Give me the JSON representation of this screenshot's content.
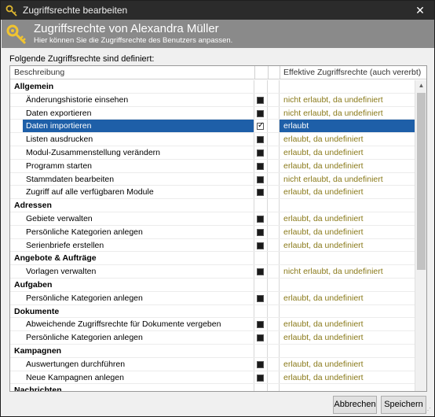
{
  "window": {
    "title": "Zugriffsrechte bearbeiten",
    "close_glyph": "✕"
  },
  "header": {
    "title": "Zugriffsrechte von Alexandra Müller",
    "subtitle": "Hier können Sie die Zugriffsrechte des Benutzers anpassen.",
    "icon": "key-icon"
  },
  "intro_text": "Folgende Zugriffsrechte sind definiert:",
  "grid": {
    "columns": [
      "Beschreibung",
      "",
      "",
      "Effektive Zugriffsrechte (auch vererbt)"
    ],
    "rows": [
      {
        "type": "group",
        "label": "Allgemein",
        "effective": ""
      },
      {
        "type": "item",
        "label": "Änderungshistorie einsehen",
        "checked": true,
        "effective": "nicht erlaubt, da undefiniert"
      },
      {
        "type": "item",
        "label": "Daten exportieren",
        "checked": true,
        "effective": "nicht erlaubt, da undefiniert"
      },
      {
        "type": "item",
        "label": "Daten importieren",
        "checked": true,
        "selected": true,
        "effective": "erlaubt"
      },
      {
        "type": "item",
        "label": "Listen ausdrucken",
        "checked": true,
        "effective": "erlaubt, da undefiniert"
      },
      {
        "type": "item",
        "label": "Modul-Zusammenstellung verändern",
        "checked": true,
        "effective": "erlaubt, da undefiniert"
      },
      {
        "type": "item",
        "label": "Programm starten",
        "checked": true,
        "effective": "erlaubt, da undefiniert"
      },
      {
        "type": "item",
        "label": "Stammdaten bearbeiten",
        "checked": true,
        "effective": "nicht erlaubt, da undefiniert"
      },
      {
        "type": "item",
        "label": "Zugriff auf alle verfügbaren Module",
        "checked": true,
        "effective": "erlaubt, da undefiniert"
      },
      {
        "type": "group",
        "label": "Adressen",
        "effective": ""
      },
      {
        "type": "item",
        "label": "Gebiete verwalten",
        "checked": true,
        "effective": "erlaubt, da undefiniert"
      },
      {
        "type": "item",
        "label": "Persönliche Kategorien anlegen",
        "checked": true,
        "effective": "erlaubt, da undefiniert"
      },
      {
        "type": "item",
        "label": "Serienbriefe erstellen",
        "checked": true,
        "effective": "erlaubt, da undefiniert"
      },
      {
        "type": "group",
        "label": "Angebote & Aufträge",
        "effective": ""
      },
      {
        "type": "item",
        "label": "Vorlagen verwalten",
        "checked": true,
        "effective": "nicht erlaubt, da undefiniert"
      },
      {
        "type": "group",
        "label": "Aufgaben",
        "effective": ""
      },
      {
        "type": "item",
        "label": "Persönliche Kategorien anlegen",
        "checked": true,
        "effective": "erlaubt, da undefiniert"
      },
      {
        "type": "group",
        "label": "Dokumente",
        "effective": ""
      },
      {
        "type": "item",
        "label": "Abweichende Zugriffsrechte für Dokumente vergeben",
        "checked": true,
        "effective": "erlaubt, da undefiniert"
      },
      {
        "type": "item",
        "label": "Persönliche Kategorien anlegen",
        "checked": true,
        "effective": "erlaubt, da undefiniert"
      },
      {
        "type": "group",
        "label": "Kampagnen",
        "effective": ""
      },
      {
        "type": "item",
        "label": "Auswertungen durchführen",
        "checked": true,
        "effective": "erlaubt, da undefiniert"
      },
      {
        "type": "item",
        "label": "Neue Kampagnen anlegen",
        "checked": true,
        "effective": "erlaubt, da undefiniert"
      },
      {
        "type": "group",
        "label": "Nachrichten",
        "effective": ""
      }
    ]
  },
  "buttons": {
    "cancel": "Abbrechen",
    "save": "Speichern"
  },
  "colors": {
    "selection": "#1e5fa8",
    "effective_text": "#8a7a1a",
    "header_bg": "#8a8a8a"
  }
}
